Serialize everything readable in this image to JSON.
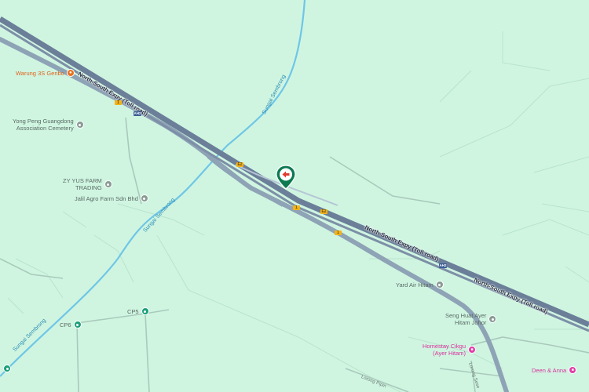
{
  "map": {
    "colors": {
      "land": "#cff5e1",
      "expressway": "#6b7f99",
      "road": "#8ea3b5",
      "river": "#6fc6e6",
      "marker": "#0d7a52",
      "marker_arrow": "#e23a2e"
    },
    "roads": {
      "expressway_top": "North-South Expy (Toll road)",
      "expressway_bottom": "North-South Expy (Toll road)",
      "route_shield": "1",
      "e_shield": "E2",
      "ah_shield": "AH2",
      "minor_road_1": "Lorong Sese",
      "minor_road_2": "Lorong Pipin"
    },
    "rivers": {
      "label_1": "Sungai Sembrong",
      "label_2": "Sungai Sembrong",
      "label_3": "Sungai Sembrong"
    },
    "places": {
      "warung": "Warung 3S Geribo",
      "yong_peng_line1": "Yong Peng Guangdong",
      "yong_peng_line2": "Association Cemetery",
      "zy_yus_line1": "ZY YUS FARM",
      "zy_yus_line2": "TRADING",
      "jalil": "Jalil Agro Farm Sdn Bhd",
      "yard": "Yard Air Hitam",
      "seng_huat_line1": "Seng Huat Ayer",
      "seng_huat_line2": "Hitam Johor",
      "homestay_line1": "Homestay Cikgu",
      "homestay_line2": "(Ayer Hitam)",
      "deen": "Deen & Anna",
      "cp5": "CP5",
      "cp6": "CP6"
    },
    "icons": {
      "warung": "restaurant-icon",
      "homestay": "hotel-icon",
      "deen": "hotel-icon",
      "marker": "location-marker-arrow-icon"
    }
  }
}
